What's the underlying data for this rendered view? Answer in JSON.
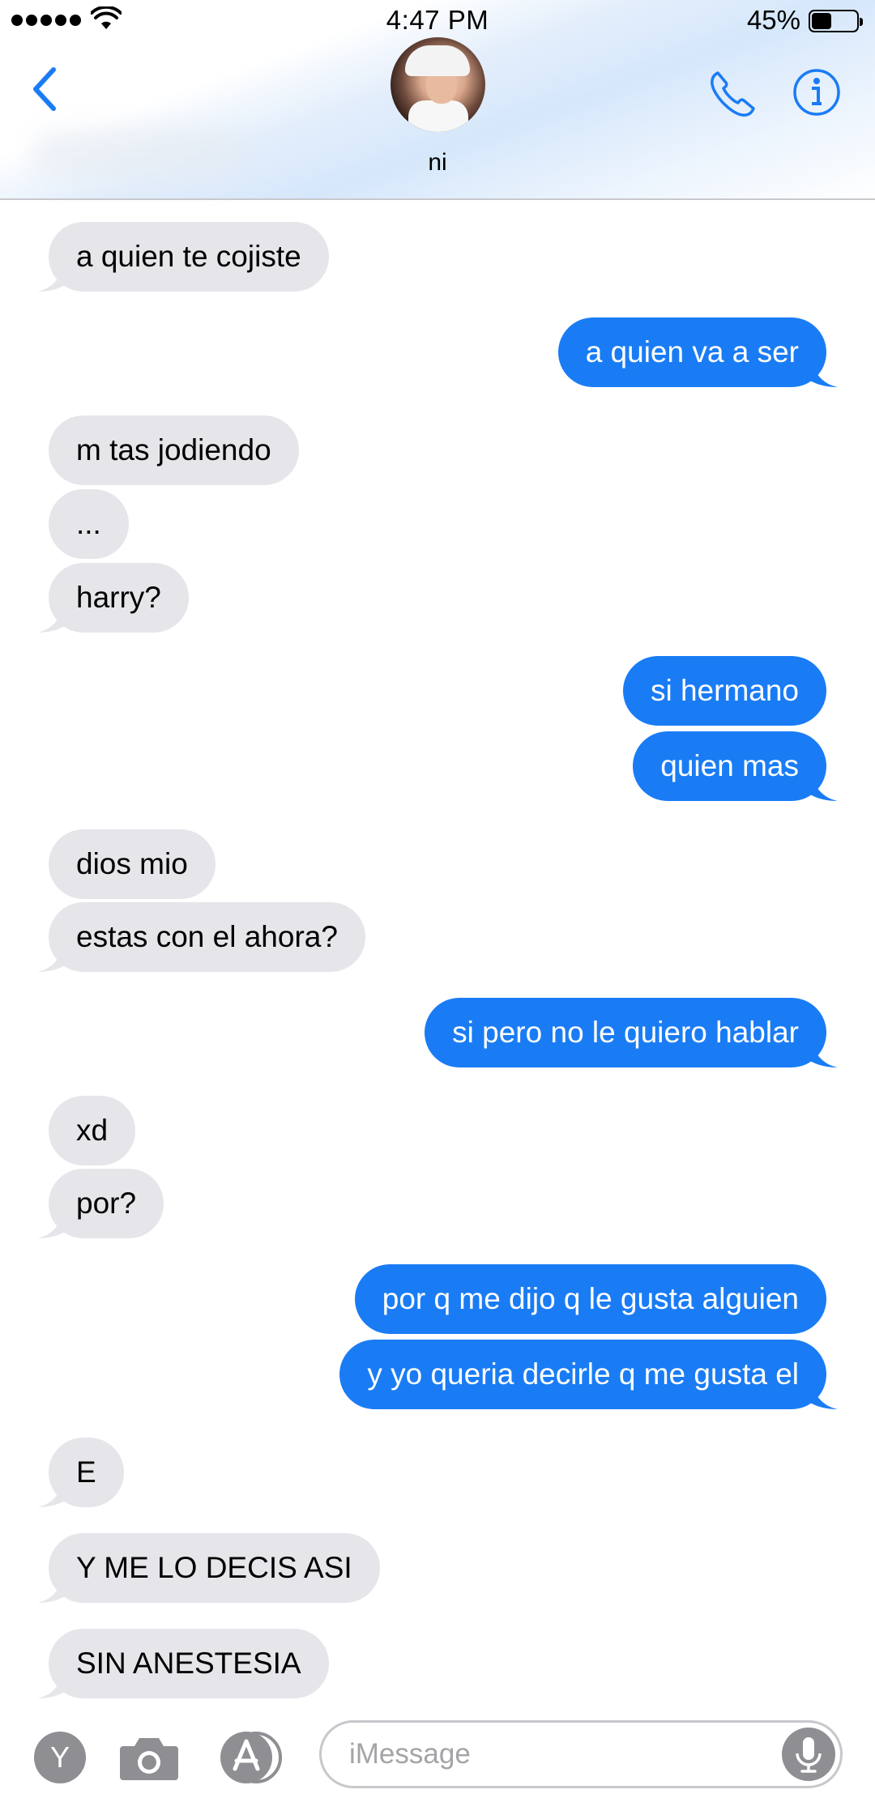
{
  "status_bar": {
    "time": "4:47 PM",
    "battery_percent": "45%",
    "battery_level": 0.45,
    "signal_bars": 5,
    "icons": [
      "signal-dots-icon",
      "wifi-icon",
      "battery-icon"
    ]
  },
  "header": {
    "contact_name": "ni",
    "icons": [
      "chevron-left-icon",
      "phone-icon",
      "info-icon"
    ]
  },
  "colors": {
    "accent": "#1a7cf5",
    "incoming_bubble": "#e5e5ea",
    "outgoing_bubble": "#1a7cf5"
  },
  "messages": [
    {
      "direction": "incoming",
      "text": "a quien te cojiste"
    },
    {
      "direction": "outgoing",
      "text": "a quien va a ser"
    },
    {
      "direction": "incoming",
      "text": "m tas jodiendo"
    },
    {
      "direction": "incoming",
      "text": "..."
    },
    {
      "direction": "incoming",
      "text": "harry?"
    },
    {
      "direction": "outgoing",
      "text": "si hermano"
    },
    {
      "direction": "outgoing",
      "text": "quien mas"
    },
    {
      "direction": "incoming",
      "text": "dios mio"
    },
    {
      "direction": "incoming",
      "text": "estas con el ahora?"
    },
    {
      "direction": "outgoing",
      "text": "si pero no le quiero hablar"
    },
    {
      "direction": "incoming",
      "text": "xd"
    },
    {
      "direction": "incoming",
      "text": "por?"
    },
    {
      "direction": "outgoing",
      "text": "por q me dijo q le gusta alguien"
    },
    {
      "direction": "outgoing",
      "text": "y yo queria decirle q me gusta el"
    },
    {
      "direction": "incoming",
      "text": "E"
    },
    {
      "direction": "incoming",
      "text": "Y ME LO DECIS ASI"
    },
    {
      "direction": "incoming",
      "text": "SIN ANESTESIA"
    }
  ],
  "input_bar": {
    "app_label": "Y",
    "placeholder": "iMessage",
    "value": "",
    "icons": [
      "app-y-icon",
      "camera-icon",
      "app-store-icon",
      "microphone-icon"
    ]
  }
}
